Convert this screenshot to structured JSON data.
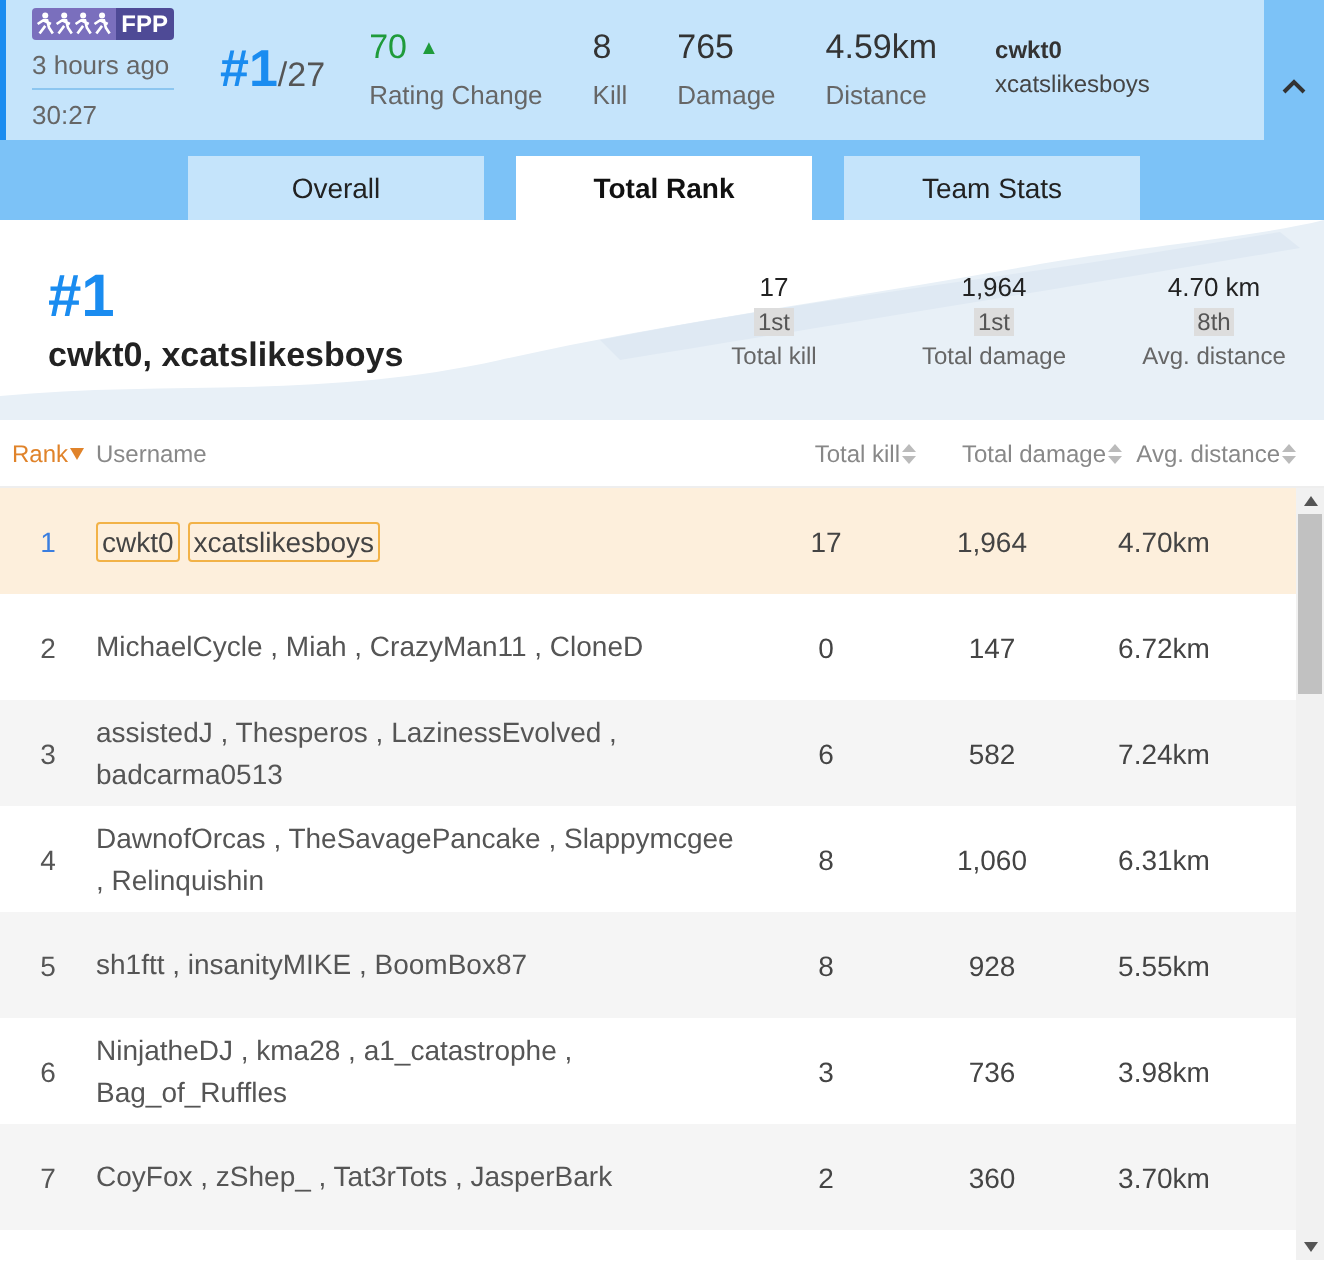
{
  "match": {
    "mode": "FPP",
    "time_ago": "3 hours ago",
    "duration": "30:27",
    "rank": "#1",
    "total": "/27",
    "stats": [
      {
        "value": "70",
        "label": "Rating Change",
        "arrow": "▲"
      },
      {
        "value": "8",
        "label": "Kill"
      },
      {
        "value": "765",
        "label": "Damage"
      },
      {
        "value": "4.59km",
        "label": "Distance"
      }
    ],
    "players": [
      "cwkt0",
      "xcatslikesboys"
    ],
    "expanded": true
  },
  "tabs": [
    {
      "label": "Overall",
      "selected": false
    },
    {
      "label": "Total Rank",
      "selected": true
    },
    {
      "label": "Team Stats",
      "selected": false
    }
  ],
  "summary": {
    "rank": "#1",
    "team": "cwkt0, xcatslikesboys",
    "stats": [
      {
        "value": "17",
        "place": "1st",
        "label": "Total kill"
      },
      {
        "value": "1,964",
        "place": "1st",
        "label": "Total damage"
      },
      {
        "value": "4.70 km",
        "place": "8th",
        "label": "Avg. distance"
      }
    ]
  },
  "table": {
    "columns": [
      {
        "label": "Rank",
        "sorted": true
      },
      {
        "label": "Username",
        "sortable": false
      },
      {
        "label": "Total kill",
        "sorted": false,
        "sortable": true
      },
      {
        "label": "Total damage",
        "sorted": false,
        "sortable": true
      },
      {
        "label": "Avg. distance",
        "sorted": false,
        "sortable": true
      }
    ],
    "rows": [
      {
        "rank": "1",
        "kind": "tags",
        "players": [
          "cwkt0",
          "xcatslikesboys"
        ],
        "kill": "17",
        "damage": "1,964",
        "distance": "4.70km",
        "selected": true
      },
      {
        "rank": "2",
        "kind": "text",
        "usernames": "MichaelCycle , Miah , CrazyMan11 , CloneD",
        "kill": "0",
        "damage": "147",
        "distance": "6.72km",
        "selected": false
      },
      {
        "rank": "3",
        "kind": "text",
        "usernames": "assistedJ , Thesperos , LazinessEvolved , badcarma0513",
        "kill": "6",
        "damage": "582",
        "distance": "7.24km",
        "selected": false
      },
      {
        "rank": "4",
        "kind": "text",
        "usernames": "DawnofOrcas , TheSavagePancake , Slappymcgee , Relinquishin",
        "kill": "8",
        "damage": "1,060",
        "distance": "6.31km",
        "selected": false
      },
      {
        "rank": "5",
        "kind": "text",
        "usernames": "sh1ftt , insanityMIKE , BoomBox87",
        "kill": "8",
        "damage": "928",
        "distance": "5.55km",
        "selected": false
      },
      {
        "rank": "6",
        "kind": "text",
        "usernames": "NinjatheDJ , kma28 , a1_catastrophe , Bag_of_Ruffles",
        "kill": "3",
        "damage": "736",
        "distance": "3.98km",
        "selected": false
      },
      {
        "rank": "7",
        "kind": "text",
        "usernames": "CoyFox , zShep_ , Tat3rTots , JasperBark",
        "kill": "2",
        "damage": "360",
        "distance": "3.70km",
        "selected": false
      }
    ]
  }
}
